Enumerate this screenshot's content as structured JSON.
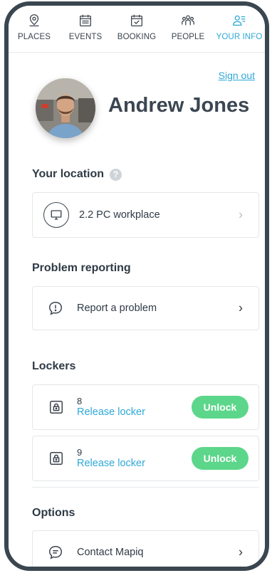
{
  "tabs": [
    {
      "label": "PLACES",
      "icon": "location-pin-icon",
      "active": false
    },
    {
      "label": "EVENTS",
      "icon": "calendar-list-icon",
      "active": false
    },
    {
      "label": "BOOKING",
      "icon": "calendar-check-icon",
      "active": false
    },
    {
      "label": "PEOPLE",
      "icon": "people-icon",
      "active": false
    },
    {
      "label": "YOUR INFO",
      "icon": "user-info-icon",
      "active": true
    }
  ],
  "header": {
    "sign_out": "Sign out",
    "user_name": "Andrew Jones"
  },
  "location": {
    "title": "Your location",
    "help": "?",
    "workplace": "2.2 PC workplace",
    "icon": "monitor-icon"
  },
  "problem": {
    "title": "Problem reporting",
    "label": "Report a problem",
    "icon": "alert-speech-icon"
  },
  "lockers": {
    "title": "Lockers",
    "items": [
      {
        "number": "8",
        "link": "Release locker",
        "button": "Unlock"
      },
      {
        "number": "9",
        "link": "Release locker",
        "button": "Unlock"
      }
    ]
  },
  "options": {
    "title": "Options",
    "contact": "Contact Mapiq",
    "icon": "chat-icon"
  },
  "colors": {
    "accent": "#2fa8d8",
    "unlock": "#5cd68a",
    "frame": "#3a4650",
    "text": "#2f3a45"
  }
}
